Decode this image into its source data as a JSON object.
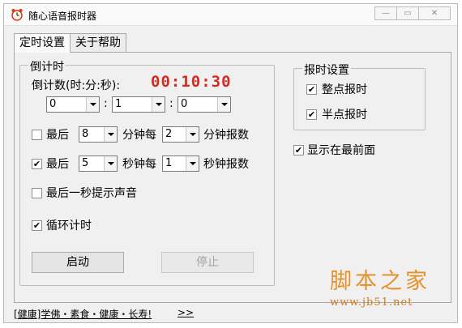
{
  "window": {
    "title": "随心语音报时器",
    "min_symbol": "—",
    "max_symbol": "▭",
    "close_symbol": "✕"
  },
  "tabs": [
    {
      "label": "定时设置",
      "active": true
    },
    {
      "label": "关于帮助",
      "active": false
    }
  ],
  "countdown": {
    "group_label": "倒计时",
    "count_label": "倒计数(时:分:秒):",
    "time_display": "00:10:30",
    "hour": "0",
    "minute": "1",
    "second": "0",
    "sep1": ":",
    "sep2": ":",
    "last_minutes": {
      "checked": false,
      "prefix": "最后",
      "value": "8",
      "middle": "分钟每",
      "interval": "2",
      "suffix": "分钟报数"
    },
    "last_seconds": {
      "checked": true,
      "prefix": "最后",
      "value": "5",
      "middle": "秒钟每",
      "interval": "1",
      "suffix": "秒钟报数"
    },
    "last_second_sound": {
      "checked": false,
      "label": "最后一秒提示声音"
    },
    "loop": {
      "checked": true,
      "label": "循环计时"
    },
    "start_label": "启动",
    "stop_label": "停止"
  },
  "announce": {
    "group_label": "报时设置",
    "hourly": {
      "checked": true,
      "label": "整点报时"
    },
    "half_hour": {
      "checked": true,
      "label": "半点报时"
    }
  },
  "topmost": {
    "checked": true,
    "label": "显示在最前面"
  },
  "status": {
    "text": "[健康]学佛・素食・健康・长寿!",
    "arrow": ">>"
  },
  "watermark": {
    "cn": "脚本之家",
    "url": "www.jb51.net"
  },
  "colors": {
    "time_red": "#d42a1f",
    "watermark_orange": "#e5922b"
  },
  "icons": {
    "app": "alarm-clock-icon",
    "check": "checkmark-icon"
  }
}
